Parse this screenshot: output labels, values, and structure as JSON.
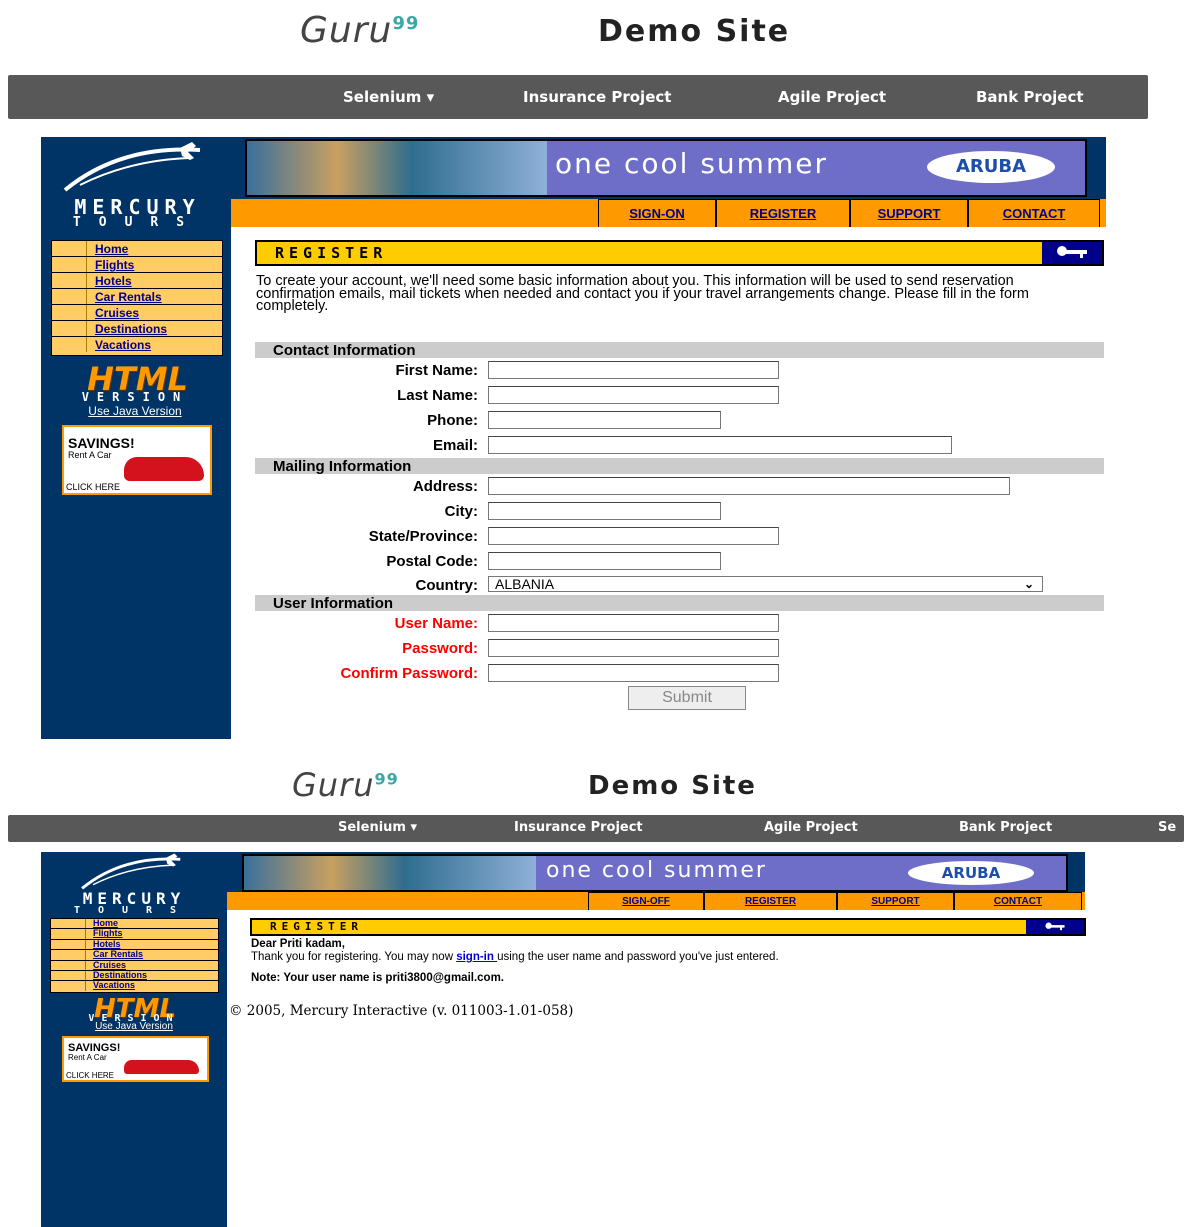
{
  "header": {
    "logo_text": "Guru",
    "logo_sup": "99",
    "site_title": "Demo Site",
    "nav": [
      "Selenium ▾",
      "Insurance Project",
      "Agile Project",
      "Bank Project",
      "Se"
    ]
  },
  "mercury": {
    "brand_line1": "MERCURY",
    "brand_line2": "TOURS",
    "menu": [
      "Home",
      "Flights",
      "Hotels",
      "Car Rentals",
      "Cruises",
      "Destinations",
      "Vacations"
    ],
    "html_logo": "HTML",
    "version_label": "VERSION",
    "java_link": "Use Java Version",
    "ad_title": "SAVINGS!",
    "ad_sub": "Rent A Car",
    "ad_click": "CLICK HERE",
    "banner_slogan": "one cool summer",
    "banner_brand": "ARUBA"
  },
  "register_form": {
    "topnav": [
      "SIGN-ON",
      "REGISTER",
      "SUPPORT",
      "CONTACT"
    ],
    "page_title": "REGISTER",
    "intro": "To create your account, we'll need some basic information about you. This information will be used to send reservation confirmation emails, mail tickets when needed and contact you if your travel arrangements change. Please fill in the form completely.",
    "contact_section": "Contact Information",
    "mailing_section": "Mailing Information",
    "user_section": "User Information",
    "labels": {
      "first_name": "First Name:",
      "last_name": "Last Name:",
      "phone": "Phone:",
      "email": "Email:",
      "address": "Address:",
      "city": "City:",
      "state": "State/Province:",
      "postal": "Postal Code:",
      "country": "Country:",
      "user_name": "User Name:",
      "password": "Password:",
      "confirm_password": "Confirm Password:"
    },
    "country_value": "ALBANIA",
    "submit_label": "Submit"
  },
  "confirmation": {
    "topnav": [
      "SIGN-OFF",
      "REGISTER",
      "SUPPORT",
      "CONTACT"
    ],
    "page_title": "REGISTER",
    "greeting": "Dear Priti kadam,",
    "thanks_before": "Thank you for registering. You may now ",
    "signin_link": "sign-in ",
    "thanks_after": "using the user name and password you've just entered.",
    "note": "Note: Your user name is priti3800@gmail.com.",
    "footer": "© 2005, Mercury Interactive (v. 011003-1.01-058)"
  }
}
